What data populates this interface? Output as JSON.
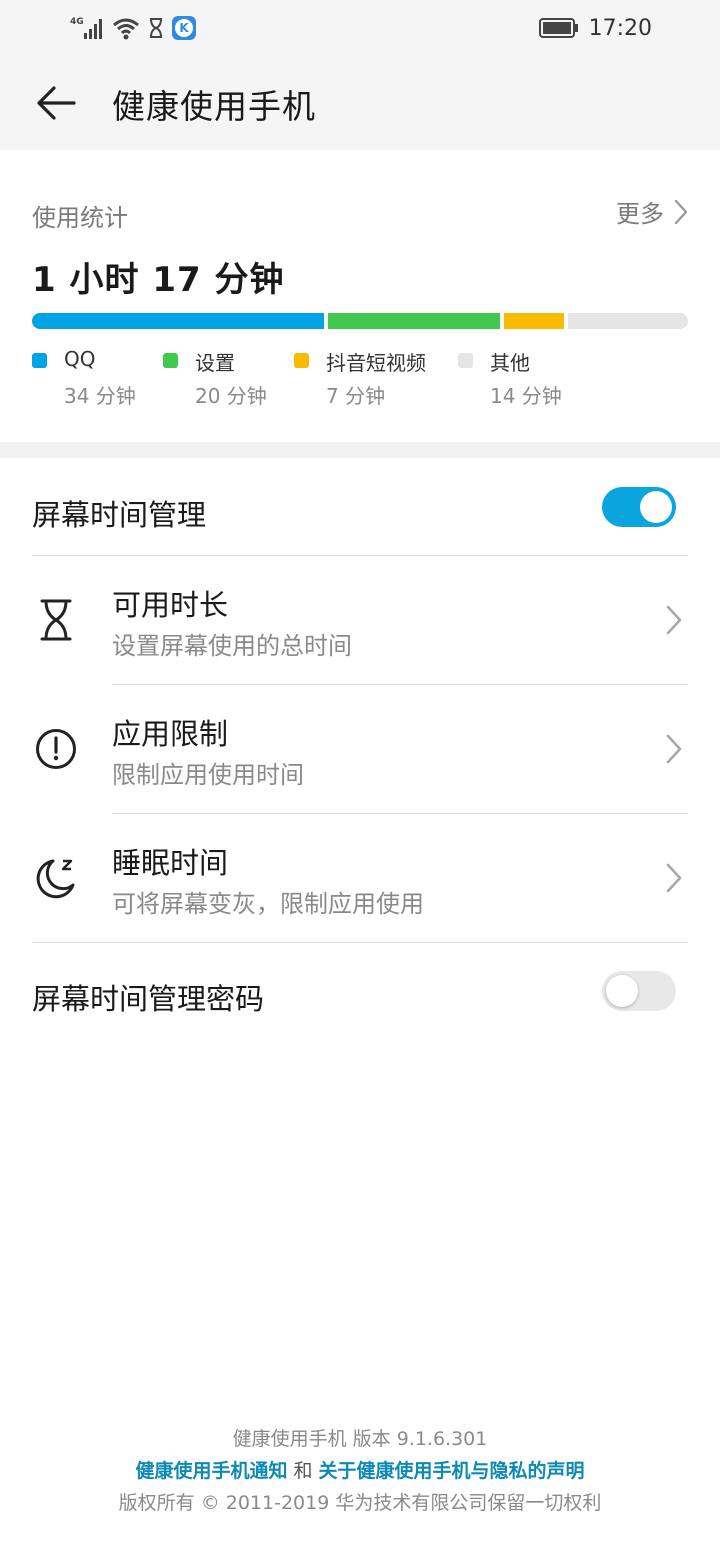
{
  "status_bar": {
    "network": "4G",
    "time": "17:20",
    "app_badge": "K"
  },
  "app_bar": {
    "title": "健康使用手机",
    "back_icon": "arrow-left-icon"
  },
  "usage": {
    "label": "使用统计",
    "more_label": "更多",
    "total": "1 小时 17 分钟",
    "items": [
      {
        "name": "QQ",
        "time": "34 分钟",
        "minutes": 34,
        "color": "#00a3e3"
      },
      {
        "name": "设置",
        "time": "20 分钟",
        "minutes": 20,
        "color": "#41c84e"
      },
      {
        "name": "抖音短视频",
        "time": "7 分钟",
        "minutes": 7,
        "color": "#f8bb00"
      },
      {
        "name": "其他",
        "time": "14 分钟",
        "minutes": 14,
        "color": "#e5e5e5"
      }
    ]
  },
  "screen_time": {
    "label": "屏幕时间管理",
    "enabled": true,
    "on_color": "#0aa5e0"
  },
  "menu": [
    {
      "title": "可用时长",
      "subtitle": "设置屏幕使用的总时间",
      "icon": "hourglass-icon"
    },
    {
      "title": "应用限制",
      "subtitle": "限制应用使用时间",
      "icon": "alert-circle-icon"
    },
    {
      "title": "睡眠时间",
      "subtitle": "可将屏幕变灰，限制应用使用",
      "icon": "moon-sleep-icon"
    }
  ],
  "password": {
    "label": "屏幕时间管理密码",
    "enabled": false
  },
  "footer": {
    "version": "健康使用手机  版本  9.1.6.301",
    "link1": "健康使用手机通知",
    "and": " 和 ",
    "link2": "关于健康使用手机与隐私的声明",
    "copyright": "版权所有 © 2011-2019 华为技术有限公司保留一切权利",
    "link_color": "#0d8ab4"
  }
}
